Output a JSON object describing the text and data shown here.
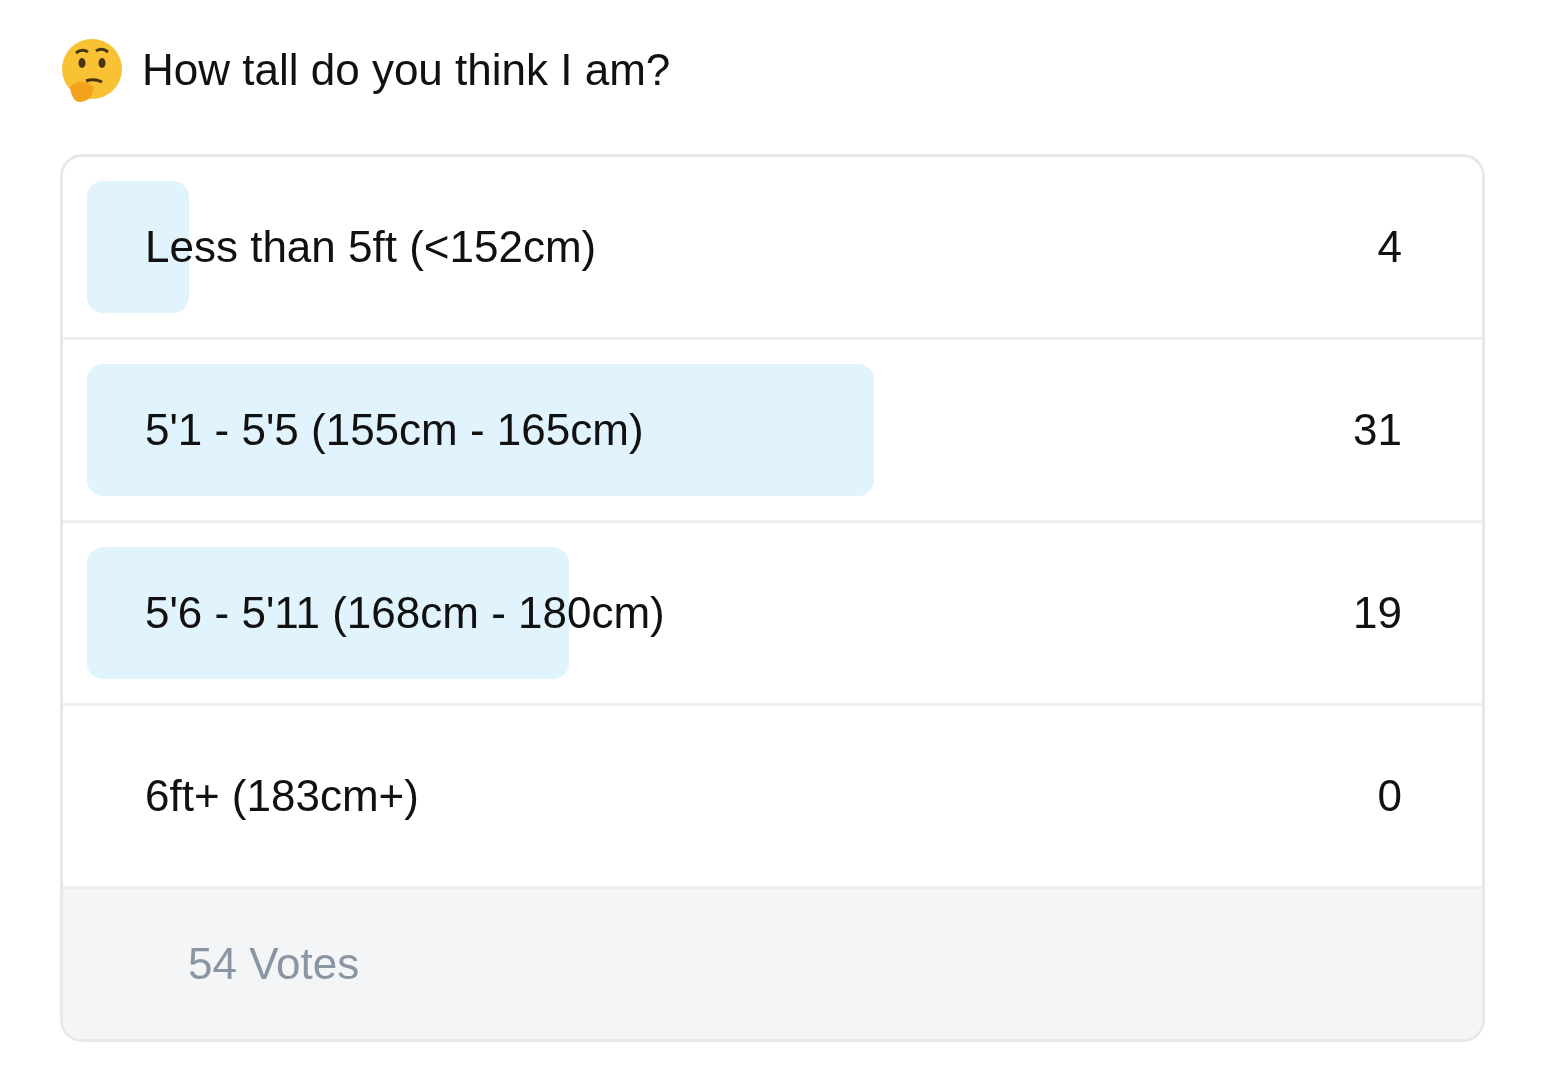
{
  "question": "How tall do you think I am?",
  "options": [
    {
      "label": "Less than 5ft (<152cm)",
      "count": "4"
    },
    {
      "label": "5'1 - 5'5 (155cm - 165cm)",
      "count": "31"
    },
    {
      "label": "5'6 - 5'11 (168cm - 180cm)",
      "count": "19"
    },
    {
      "label": "6ft+ (183cm+)",
      "count": "0"
    }
  ],
  "total": "54 Votes"
}
